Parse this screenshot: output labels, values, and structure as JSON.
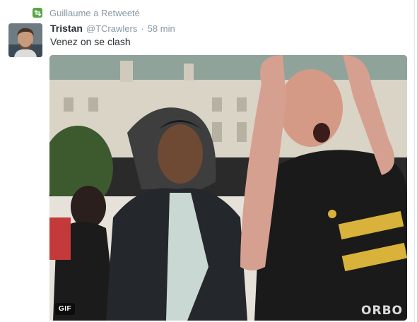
{
  "retweet": {
    "text": "Guillaume a Retweeté",
    "icon": "retweet-icon",
    "icon_color": "#5aa645"
  },
  "tweet": {
    "name": "Tristan",
    "handle": "@TCrawlers",
    "separator": "·",
    "time": "58 min",
    "text": "Venez on se clash"
  },
  "media": {
    "badge": "GIF",
    "watermark": "ORBO"
  },
  "colors": {
    "muted": "#8899a6",
    "text": "#292f33"
  }
}
